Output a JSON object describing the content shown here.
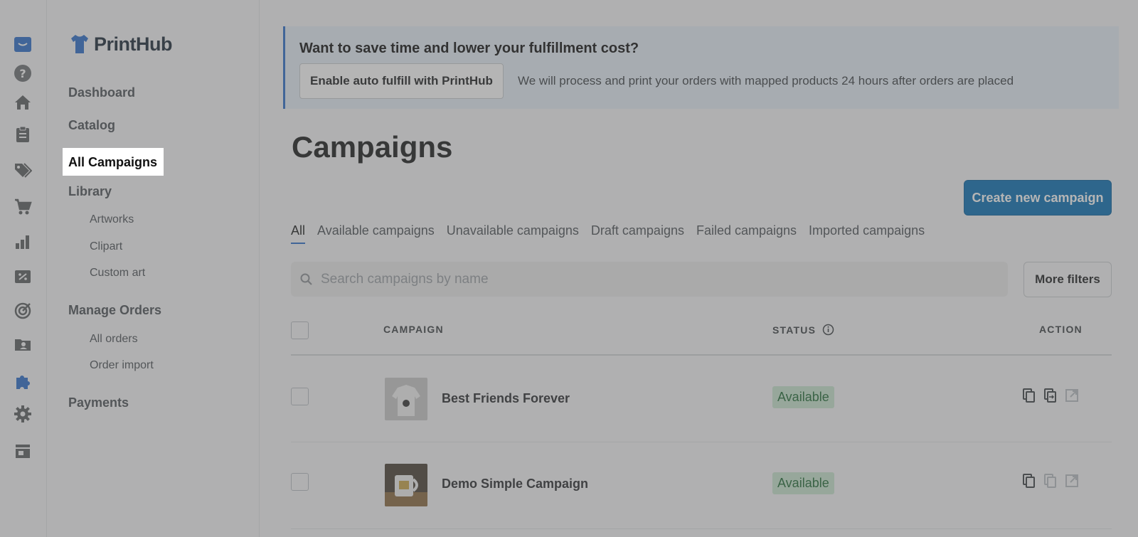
{
  "app": {
    "name": "PrintHub"
  },
  "sidebar": {
    "items": [
      {
        "label": "Dashboard"
      },
      {
        "label": "Catalog"
      },
      {
        "label": "All Campaigns"
      },
      {
        "label": "Library"
      },
      {
        "label": "Artworks"
      },
      {
        "label": "Clipart"
      },
      {
        "label": "Custom art"
      },
      {
        "label": "Manage Orders"
      },
      {
        "label": "All orders"
      },
      {
        "label": "Order import"
      },
      {
        "label": "Payments"
      }
    ]
  },
  "rail": {
    "icons": [
      "shopify-bag-icon",
      "help-icon",
      "home-icon",
      "orders-icon",
      "products-icon",
      "cart-icon",
      "analytics-icon",
      "discounts-icon",
      "marketing-icon",
      "customers-icon",
      "apps-icon",
      "settings-icon",
      "store-icon"
    ]
  },
  "banner": {
    "title": "Want to save time and lower your fulfillment cost?",
    "button_label": "Enable auto fulfill with PrintHub",
    "description": "We will process and print your orders with mapped products 24 hours after orders are placed"
  },
  "page": {
    "title": "Campaigns",
    "create_label": "Create new campaign"
  },
  "tabs": [
    {
      "label": "All",
      "active": true
    },
    {
      "label": "Available campaigns"
    },
    {
      "label": "Unavailable campaigns"
    },
    {
      "label": "Draft campaigns"
    },
    {
      "label": "Failed campaigns"
    },
    {
      "label": "Imported campaigns"
    }
  ],
  "search": {
    "placeholder": "Search campaigns by name",
    "filters_label": "More filters"
  },
  "table": {
    "headers": {
      "campaign": "CAMPAIGN",
      "status": "STATUS",
      "action": "ACTION"
    },
    "rows": [
      {
        "name": "Best Friends Forever",
        "status": "Available"
      },
      {
        "name": "Demo Simple Campaign",
        "status": "Available"
      }
    ]
  },
  "colors": {
    "accent": "#0a6fb5",
    "status_bg": "#c9e6cf",
    "status_text": "#1f6b35"
  }
}
